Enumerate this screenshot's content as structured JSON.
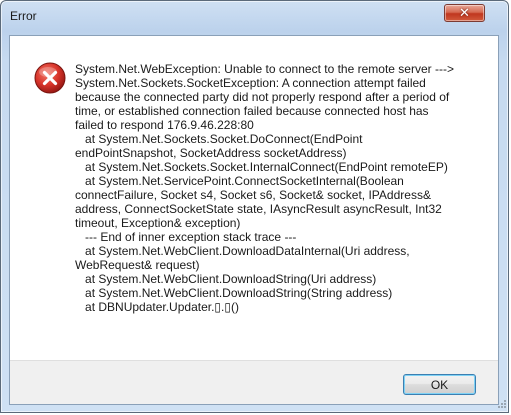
{
  "window": {
    "title": "Error",
    "close_glyph": "✕"
  },
  "message": {
    "icon": "error-icon",
    "text": "System.Net.WebException: Unable to connect to the remote server --->\nSystem.Net.Sockets.SocketException: A connection attempt failed\nbecause the connected party did not properly respond after a period of\ntime, or established connection failed because connected host has\nfailed to respond 176.9.46.228:80\n   at System.Net.Sockets.Socket.DoConnect(EndPoint\nendPointSnapshot, SocketAddress socketAddress)\n   at System.Net.Sockets.Socket.InternalConnect(EndPoint remoteEP)\n   at System.Net.ServicePoint.ConnectSocketInternal(Boolean\nconnectFailure, Socket s4, Socket s6, Socket& socket, IPAddress&\naddress, ConnectSocketState state, IAsyncResult asyncResult, Int32\ntimeout, Exception& exception)\n   --- End of inner exception stack trace ---\n   at System.Net.WebClient.DownloadDataInternal(Uri address,\nWebRequest& request)\n   at System.Net.WebClient.DownloadString(Uri address)\n   at System.Net.WebClient.DownloadString(String address)\n   at DBNUpdater.Updater.▯.▯()"
  },
  "buttons": {
    "ok_label": "OK"
  },
  "colors": {
    "error_red": "#d8342a",
    "frame_blue": "#bcd2ec",
    "button_focus": "#3c7fb1"
  }
}
